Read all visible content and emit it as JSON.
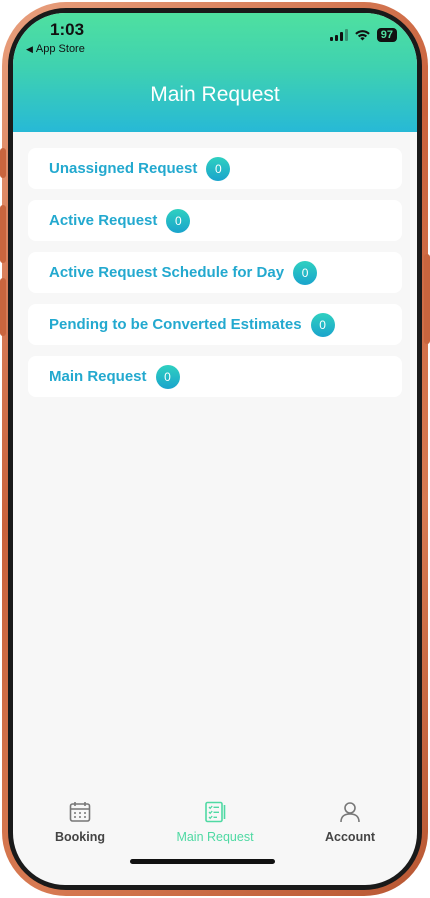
{
  "status_bar": {
    "time": "1:03",
    "back_app": "App Store",
    "battery": "97"
  },
  "header": {
    "title": "Main Request"
  },
  "requests": [
    {
      "label": "Unassigned Request",
      "count": "0"
    },
    {
      "label": "Active Request",
      "count": "0"
    },
    {
      "label": "Active Request Schedule for Day",
      "count": "0"
    },
    {
      "label": "Pending to be Converted Estimates",
      "count": "0"
    },
    {
      "label": "Main Request",
      "count": "0"
    }
  ],
  "tabbar": {
    "tabs": [
      {
        "label": "Booking",
        "icon": "calendar-icon",
        "active": false
      },
      {
        "label": "Main Request",
        "icon": "clipboard-list-icon",
        "active": true
      },
      {
        "label": "Account",
        "icon": "user-icon",
        "active": false
      }
    ]
  },
  "colors": {
    "header_top": "#4fe0a0",
    "header_bottom": "#27b9d6",
    "row_text": "#23a9cf",
    "active_tab": "#4fd9a3"
  }
}
